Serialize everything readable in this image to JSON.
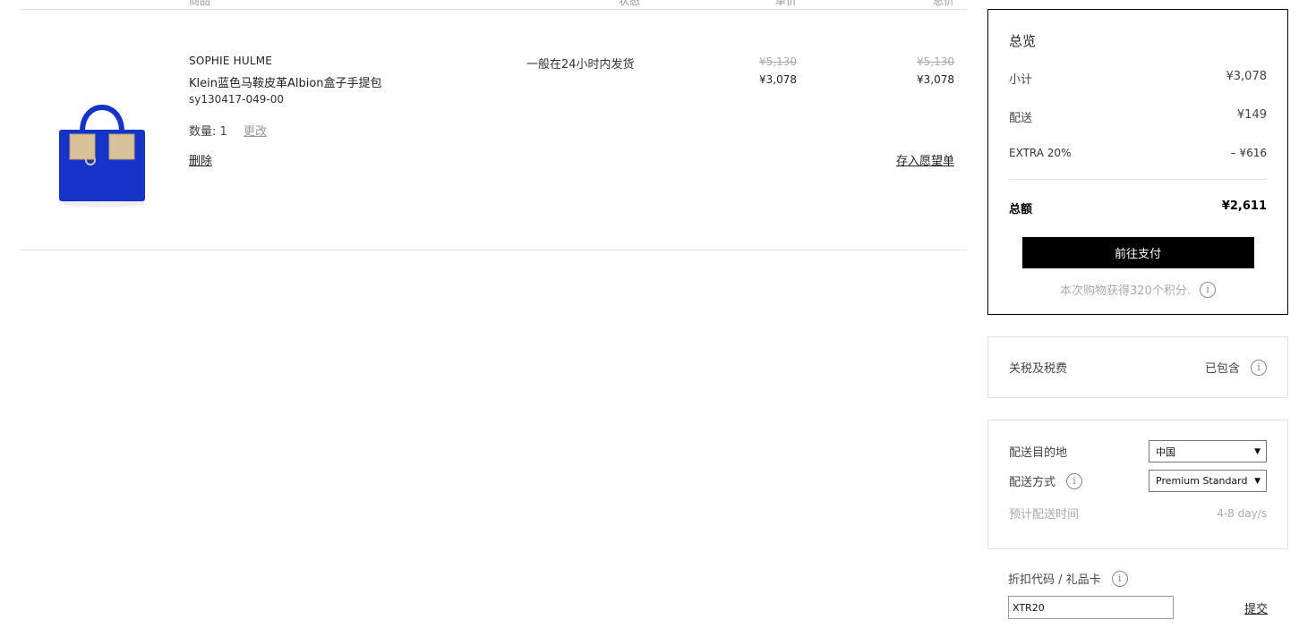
{
  "columns": {
    "item": "商品",
    "status": "状态",
    "unit_price": "单价",
    "total": "总价"
  },
  "item": {
    "brand": "SOPHIE HULME",
    "name": "Klein蓝色马鞍皮革Albion盒子手提包",
    "sku": "sy130417-049-00",
    "qty_label": "数量: 1",
    "change_label": "更改",
    "remove_label": "删除",
    "wishlist_label": "存入愿望单",
    "ship_note": "一般在24小时内发货",
    "unit_old": "¥5,130",
    "unit_now": "¥3,078",
    "total_old": "¥5,130",
    "total_now": "¥3,078",
    "image_color": "#1533c9"
  },
  "summary": {
    "title": "总览",
    "subtotal_label": "小计",
    "subtotal": "¥3,078",
    "shipping_label": "配送",
    "shipping": "¥149",
    "discount_label": "EXTRA 20%",
    "discount": "– ¥616",
    "grand_label": "总额",
    "grand": "¥2,611",
    "checkout_label": "前往支付",
    "points": "本次购物获得320个积分."
  },
  "duties": {
    "label": "关税及税费",
    "value": "已包含"
  },
  "shipping_opts": {
    "dest_label": "配送目的地",
    "dest_value": "中国",
    "method_label": "配送方式",
    "method_value": "Premium Standard Del",
    "eta_label": "预计配送时间",
    "eta_value": "4-8 day/s"
  },
  "coupon": {
    "label": "折扣代码 / 礼品卡",
    "value": "XTR20",
    "submit_label": "提交"
  },
  "icons": {
    "info": "info-icon",
    "dropdown": "chevron-down-icon",
    "bag": "handbag-image"
  }
}
